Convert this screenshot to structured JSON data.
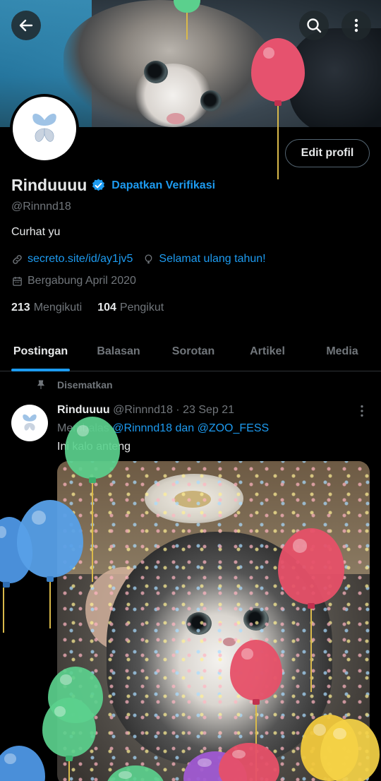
{
  "header": {
    "back_icon": "arrow-left-icon",
    "search_icon": "search-icon",
    "more_icon": "more-vertical-icon"
  },
  "profile": {
    "name": "Rinduuuu",
    "verify_link": "Dapatkan Verifikasi",
    "handle": "@Rinnnd18",
    "bio": "Curhat yu",
    "website": "secreto.site/id/ay1jv5",
    "birthday": "Selamat ulang tahun!",
    "joined": "Bergabung April 2020",
    "following_count": "213",
    "following_label": "Mengikuti",
    "followers_count": "104",
    "followers_label": "Pengikut",
    "edit_button": "Edit profil"
  },
  "tabs": [
    {
      "label": "Postingan",
      "active": true
    },
    {
      "label": "Balasan",
      "active": false
    },
    {
      "label": "Sorotan",
      "active": false
    },
    {
      "label": "Artikel",
      "active": false
    },
    {
      "label": "Media",
      "active": false
    }
  ],
  "pinned_post": {
    "pinned_label": "Disematkan",
    "author_name": "Rinduuuu",
    "author_handle": "@Rinnnd18",
    "separator": "·",
    "date": "23 Sep 21",
    "reply_prefix": "Membalas",
    "reply_mentions": "@Rinnnd18 dan @ZOO_FESS",
    "text": "Ini kalo anteng"
  },
  "colors": {
    "accent": "#1d9bf0",
    "background": "#000000",
    "text_primary": "#e7e9ea",
    "text_secondary": "#71767b"
  }
}
